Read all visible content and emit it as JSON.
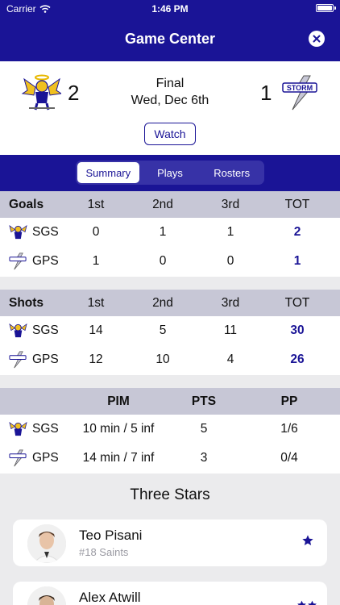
{
  "status_bar": {
    "carrier": "Carrier",
    "time": "1:46 PM"
  },
  "header": {
    "title": "Game Center"
  },
  "game": {
    "home_score": "2",
    "away_score": "1",
    "status": "Final",
    "date": "Wed, Dec 6th",
    "watch_label": "Watch"
  },
  "tabs": [
    "Summary",
    "Plays",
    "Rosters"
  ],
  "goals": {
    "headers": [
      "Goals",
      "1st",
      "2nd",
      "3rd",
      "TOT"
    ],
    "rows": [
      {
        "team": "SGS",
        "p1": "0",
        "p2": "1",
        "p3": "1",
        "tot": "2"
      },
      {
        "team": "GPS",
        "p1": "1",
        "p2": "0",
        "p3": "0",
        "tot": "1"
      }
    ]
  },
  "shots": {
    "headers": [
      "Shots",
      "1st",
      "2nd",
      "3rd",
      "TOT"
    ],
    "rows": [
      {
        "team": "SGS",
        "p1": "14",
        "p2": "5",
        "p3": "11",
        "tot": "30"
      },
      {
        "team": "GPS",
        "p1": "12",
        "p2": "10",
        "p3": "4",
        "tot": "26"
      }
    ]
  },
  "penalties": {
    "headers": [
      "PIM",
      "PTS",
      "PP"
    ],
    "rows": [
      {
        "team": "SGS",
        "pim": "10 min / 5 inf",
        "pts": "5",
        "pp": "1/6"
      },
      {
        "team": "GPS",
        "pim": "14 min / 7 inf",
        "pts": "3",
        "pp": "0/4"
      }
    ]
  },
  "three_stars": {
    "title": "Three Stars",
    "players": [
      {
        "name": "Teo Pisani",
        "detail": "#18 Saints",
        "stars": 1
      },
      {
        "name": "Alex Atwill",
        "detail": "",
        "stars": 2
      }
    ]
  },
  "colors": {
    "primary": "#1a1496",
    "header_row": "#c7c7d6",
    "background": "#ebebed"
  },
  "icons": {
    "close": "close-icon",
    "star": "star-icon",
    "home_logo": "saints-logo",
    "away_logo": "storm-logo"
  }
}
